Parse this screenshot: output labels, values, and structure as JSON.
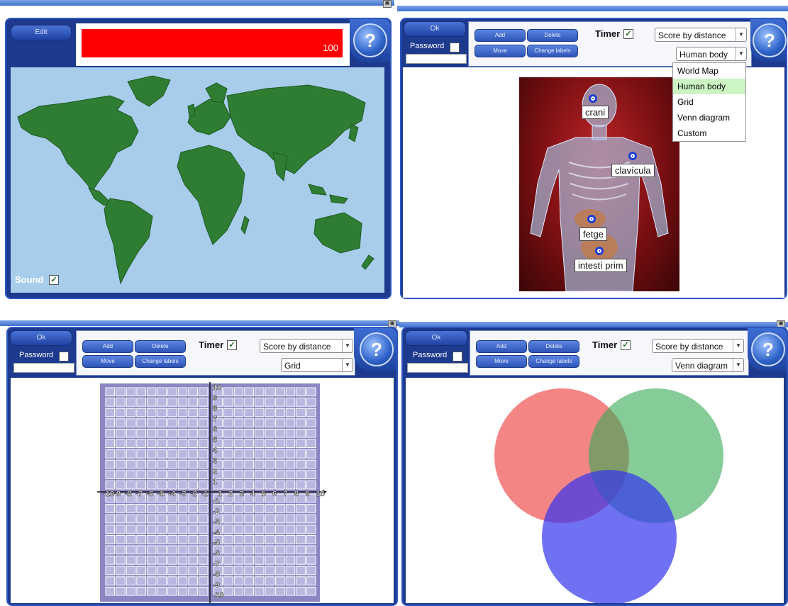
{
  "panel_map": {
    "edit_label": "Edit",
    "score": "100",
    "sound_label": "Sound",
    "sound_checked": "✓",
    "help": "?",
    "colors": {
      "ocean": "#a7cdeb",
      "land": "#2f7d32",
      "score_bar": "#ff0000"
    }
  },
  "panel_body": {
    "ok_label": "Ok",
    "password_label": "Password",
    "add_label": "Add",
    "delete_label": "Delete",
    "move_label": "Move",
    "change_labels": "Change labels",
    "timer_label": "Timer",
    "timer_checked": "✓",
    "score_mode": "Score by distance",
    "template": "Human body",
    "help": "?",
    "dropdown_options": [
      "World Map",
      "Human body",
      "Grid",
      "Venn diagram",
      "Custom"
    ],
    "labels": [
      "crani",
      "clavícula",
      "fetge",
      "intestí prim"
    ]
  },
  "panel_grid": {
    "ok_label": "Ok",
    "password_label": "Password",
    "add_label": "Add",
    "delete_label": "Delete",
    "move_label": "Move",
    "change_labels": "Change labels",
    "timer_label": "Timer",
    "timer_checked": "✓",
    "score_mode": "Score by distance",
    "template": "Grid",
    "help": "?",
    "x_ticks": [
      "-10",
      "-9",
      "-8",
      "-7",
      "-6",
      "-5",
      "-4",
      "-3",
      "-2",
      "-1",
      "1",
      "2",
      "3",
      "4",
      "5",
      "6",
      "7",
      "8",
      "9",
      "10"
    ],
    "y_ticks": [
      "10",
      "9",
      "8",
      "7",
      "6",
      "5",
      "4",
      "3",
      "2",
      "1",
      "-1",
      "-2",
      "-3",
      "-4",
      "-5",
      "-6",
      "-7",
      "-8",
      "-9",
      "-10"
    ],
    "colors": {
      "grid_bg": "#8c87c4",
      "cell": "#b9b6df"
    }
  },
  "panel_venn": {
    "ok_label": "Ok",
    "password_label": "Password",
    "add_label": "Add",
    "delete_label": "Delete",
    "move_label": "Move",
    "change_labels": "Change labels",
    "timer_label": "Timer",
    "timer_checked": "✓",
    "score_mode": "Score by distance",
    "template": "Venn diagram",
    "help": "?",
    "colors": {
      "red": "#ee4444",
      "green": "#33aa55",
      "blue": "#3333ee"
    }
  },
  "window": {
    "close_glyph": "▣"
  }
}
